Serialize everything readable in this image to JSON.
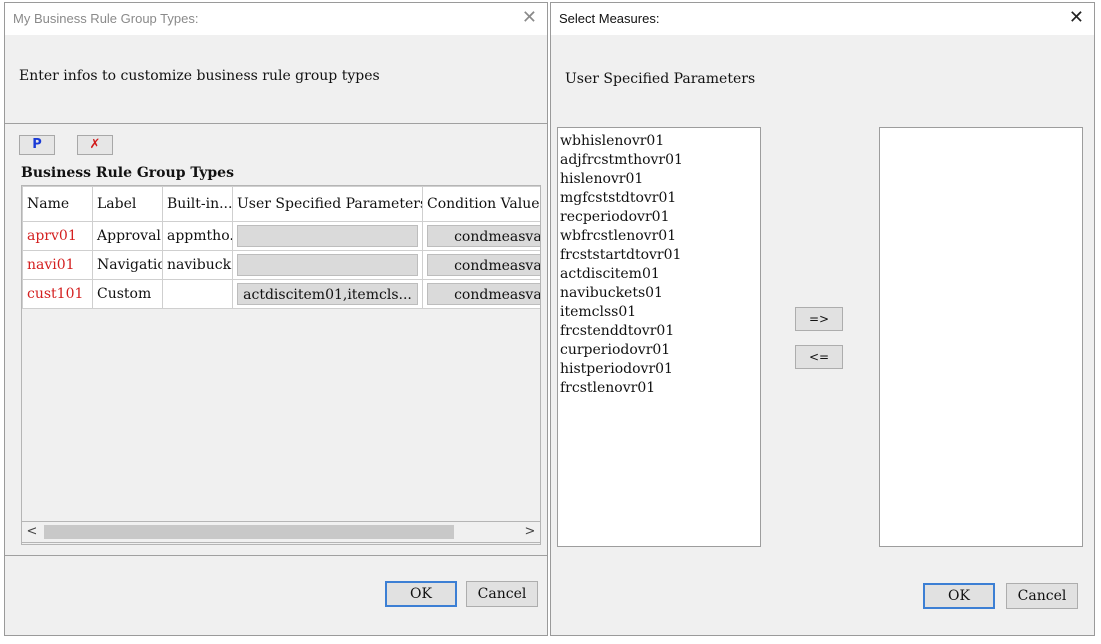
{
  "left_dialog": {
    "title": "My Business Rule Group Types:",
    "close_glyph": "✕",
    "header_text": "Enter infos to customize business rule group types",
    "toolbar": {
      "param_glyph": "P",
      "delete_glyph": "✗"
    },
    "section_title": "Business Rule Group Types",
    "table": {
      "columns": [
        "Name",
        "Label",
        "Built-in...",
        "User Specified Parameters",
        "Condition Value I"
      ],
      "rows": [
        {
          "name": "aprv01",
          "label": "Approval",
          "builtin": "appmtho...",
          "params": "",
          "condition": "condmeasvalnur"
        },
        {
          "name": "navi01",
          "label": "Navigation",
          "builtin": "navibuck...",
          "params": "",
          "condition": "condmeasvalnur"
        },
        {
          "name": "cust101",
          "label": "Custom",
          "builtin": "",
          "params": "actdiscitem01,itemcls...",
          "condition": "condmeasvalnur"
        }
      ]
    },
    "scrollbar": {
      "left_glyph": "<",
      "right_glyph": ">"
    },
    "ok_label": "OK",
    "cancel_label": "Cancel"
  },
  "right_dialog": {
    "title": "Select Measures:",
    "close_glyph": "✕",
    "header_text": "User Specified Parameters",
    "available_items": [
      "wbhislenovr01",
      "adjfrcstmthovr01",
      "hislenovr01",
      "mgfcststdtovr01",
      "recperiodovr01",
      "wbfrcstlenovr01",
      "frcststartdtovr01",
      "actdiscitem01",
      "navibuckets01",
      "itemclss01",
      "frcstenddtovr01",
      "curperiodovr01",
      "histperiodovr01",
      "frcstlenovr01"
    ],
    "selected_items": [],
    "move_right_label": "=>",
    "move_left_label": "<=",
    "ok_label": "OK",
    "cancel_label": "Cancel"
  }
}
